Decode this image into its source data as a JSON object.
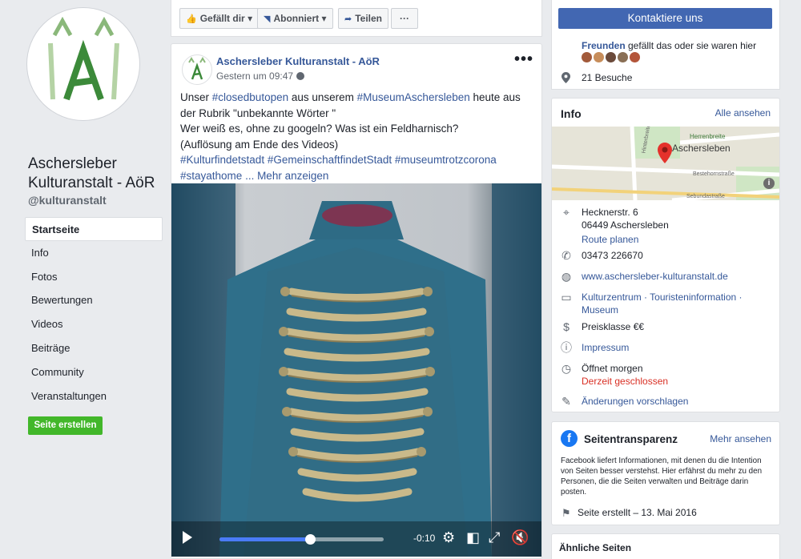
{
  "page": {
    "name": "Aschersleber Kulturanstalt - AöR",
    "handle": "@kulturanstalt"
  },
  "nav": {
    "items": [
      {
        "label": "Startseite",
        "active": true
      },
      {
        "label": "Info"
      },
      {
        "label": "Fotos"
      },
      {
        "label": "Bewertungen"
      },
      {
        "label": "Videos"
      },
      {
        "label": "Beiträge"
      },
      {
        "label": "Community"
      },
      {
        "label": "Veranstaltungen"
      }
    ],
    "create_page_label": "Seite erstellen"
  },
  "actions": {
    "like_label": "Gefällt dir",
    "follow_label": "Abonniert",
    "share_label": "Teilen",
    "more_label": "···"
  },
  "post": {
    "author": "Aschersleber Kulturanstalt - AöR",
    "time": "Gestern um 09:47",
    "menu": "•••",
    "text": {
      "p1_a": "Unser ",
      "p1_tag1": "#closedbutopen",
      "p1_b": " aus unserem ",
      "p1_tag2": "#MuseumAschersleben",
      "p1_c": " heute aus der Rubrik \"unbekannte Wörter \"",
      "p2": "Wer weiß es, ohne zu googeln? Was ist ein Feldharnisch?",
      "p3": "(Auflösung am Ende des Videos)",
      "tags_line": "#Kulturfindetstadt #GemeinschaftfindetStadt #museumtrotzcorona",
      "last_tag": "#stayathome",
      "more": "... Mehr anzeigen"
    },
    "video": {
      "time_remaining": "-0:10",
      "progress": 0.55
    }
  },
  "sidebar": {
    "contact_label": "Kontaktiere uns",
    "community": {
      "friends_bold": "Freunden",
      "friends_rest": " gefällt das oder sie waren hier",
      "visits": "21 Besuche"
    },
    "info": {
      "title": "Info",
      "see_all": "Alle ansehen",
      "map_label_city": "Aschersleben",
      "map_label_street1": "Herrenbreite",
      "map_label_street2": "Hinterbreite",
      "map_label_street3": "Bestehornstraße",
      "map_label_street4": "Sebundastraße",
      "address_line1": "Hecknerstr. 6",
      "address_line2": "06449 Aschersleben",
      "route": "Route planen",
      "phone": "03473 226670",
      "website": "www.aschersleber-kulturanstalt.de",
      "category_line1": "Kulturzentrum · Touristeninformation ·",
      "category_line2": "Museum",
      "price": "Preisklasse €€",
      "imprint": "Impressum",
      "opens": "Öffnet morgen",
      "closed": "Derzeit geschlossen",
      "suggest": "Änderungen vorschlagen"
    },
    "transparency": {
      "title": "Seitentransparenz",
      "see_more": "Mehr ansehen",
      "text": "Facebook liefert Informationen, mit denen du die Intention von Seiten besser verstehst. Hier erfährst du mehr zu den Personen, die die Seiten verwalten und Beiträge darin posten.",
      "created": "Seite erstellt – 13. Mai 2016"
    },
    "similar_title": "Ähnliche Seiten"
  },
  "colors": {
    "link": "#365899",
    "primary_button": "#4267b2",
    "create_button": "#42b72a",
    "closed_red": "#d93025"
  }
}
